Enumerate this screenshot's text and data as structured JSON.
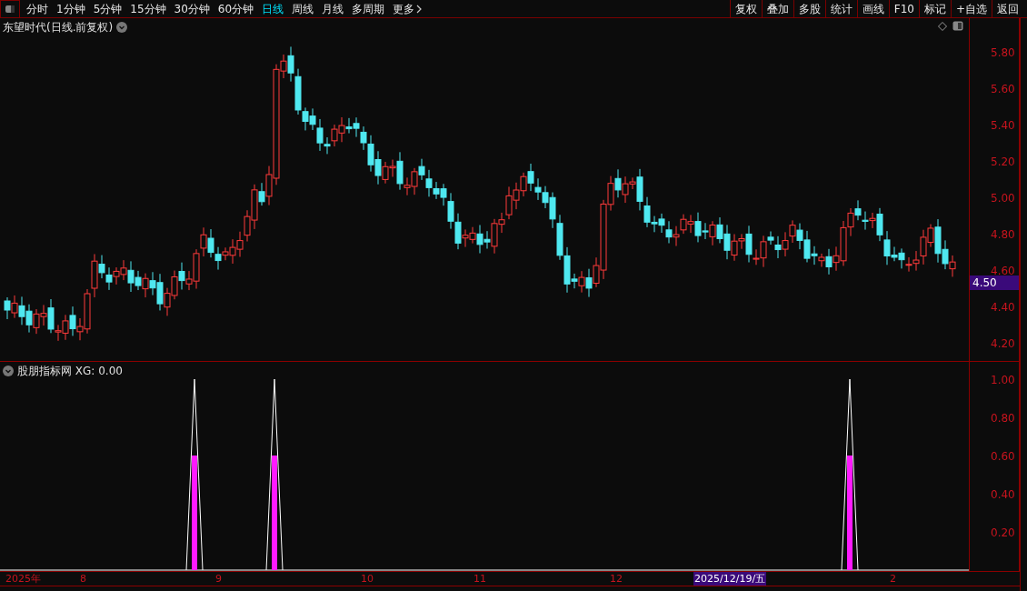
{
  "toolbar": {
    "periods": [
      {
        "label": "分时",
        "selected": false
      },
      {
        "label": "1分钟",
        "selected": false
      },
      {
        "label": "5分钟",
        "selected": false
      },
      {
        "label": "15分钟",
        "selected": false
      },
      {
        "label": "30分钟",
        "selected": false
      },
      {
        "label": "60分钟",
        "selected": false
      },
      {
        "label": "日线",
        "selected": true
      },
      {
        "label": "周线",
        "selected": false
      },
      {
        "label": "月线",
        "selected": false
      },
      {
        "label": "多周期",
        "selected": false
      }
    ],
    "more": "更多",
    "buttons": [
      "复权",
      "叠加",
      "多股",
      "统计",
      "画线",
      "F10",
      "标记",
      "+自选",
      "返回"
    ]
  },
  "main_chart": {
    "title": "东望时代(日线.前复权)",
    "price_ticks": [
      "5.80",
      "5.60",
      "5.40",
      "5.20",
      "5.00",
      "4.80",
      "4.60",
      "4.40",
      "4.20"
    ],
    "current_price": "4.50"
  },
  "indicator": {
    "title": "股朋指标网 XG: 0.00",
    "ticks": [
      "1.00",
      "0.80",
      "0.60",
      "0.40",
      "0.20"
    ]
  },
  "date_axis": {
    "labels": [
      {
        "text": "2025年",
        "selected": false
      },
      {
        "text": "8",
        "selected": false
      },
      {
        "text": "9",
        "selected": false
      },
      {
        "text": "10",
        "selected": false
      },
      {
        "text": "11",
        "selected": false
      },
      {
        "text": "12",
        "selected": false
      },
      {
        "text": "2025/12/19/五",
        "selected": true
      },
      {
        "text": "2",
        "selected": false
      }
    ]
  }
}
